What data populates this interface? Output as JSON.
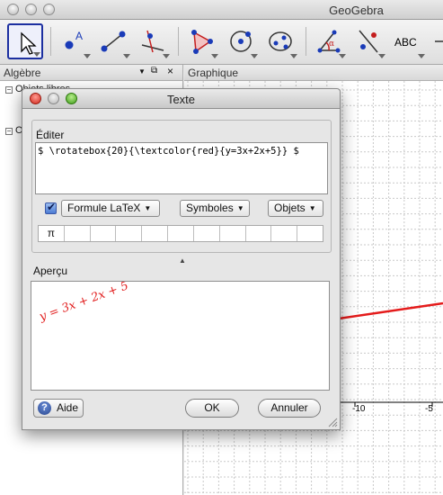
{
  "app": {
    "title": "GeoGebra",
    "algebra_panel_title": "Algèbre",
    "graphics_panel_title": "Graphique",
    "algebra_nodes": [
      "Objets libres",
      "O"
    ]
  },
  "graph": {
    "x_ticks": [
      "-10",
      "-5"
    ],
    "line_color": "#e41b1b"
  },
  "dialog": {
    "title": "Texte",
    "edit_label": "Éditer",
    "edit_text": "$ \\rotatebox{20}{\\textcolor{red}{y=3x+2x+5}} $",
    "latex_label": "Formule LaTeX",
    "symbols_label": "Symboles",
    "objects_label": "Objets",
    "symbols": [
      "π",
      "",
      "",
      "",
      "",
      "",
      "",
      "",
      "",
      "",
      ""
    ],
    "preview_label": "Aperçu",
    "preview_formula": "y = 3x + 2x + 5",
    "preview_color": "#e11d1d",
    "help_label": "Aide",
    "ok_label": "OK",
    "cancel_label": "Annuler"
  },
  "toolbar": {
    "icons": [
      "move-tool",
      "point-tool",
      "line-tool",
      "perpendicular-tool",
      "polygon-tool",
      "circle-tool",
      "conic-tool",
      "angle-tool",
      "reflect-tool",
      "text-tool",
      "slider-tool"
    ],
    "text_tool_label": "ABC"
  }
}
